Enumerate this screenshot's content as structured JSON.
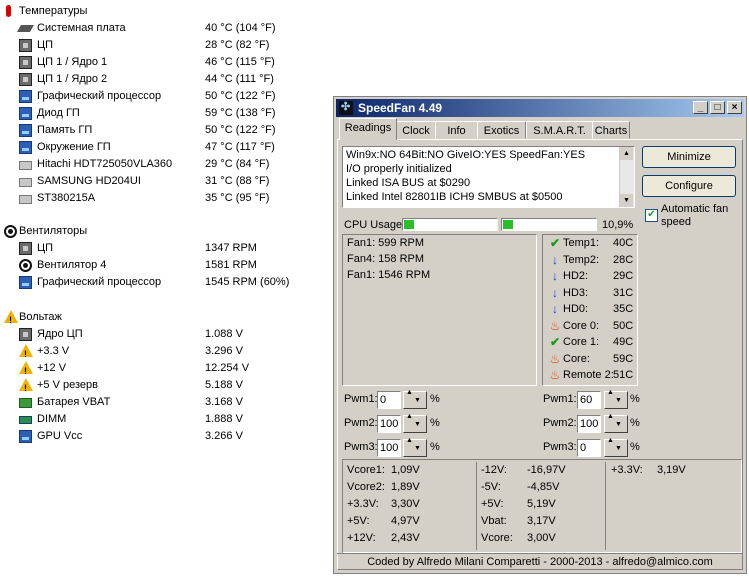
{
  "sensors": {
    "temps_header": "Температуры",
    "temps": [
      {
        "name": "Системная плата",
        "value": "40 °C  (104 °F)",
        "icon": "motherboard-icon"
      },
      {
        "name": "ЦП",
        "value": "28 °C  (82 °F)",
        "icon": "cpu-icon"
      },
      {
        "name": "ЦП 1 / Ядро 1",
        "value": "46 °C  (115 °F)",
        "icon": "cpu-icon"
      },
      {
        "name": "ЦП 1 / Ядро 2",
        "value": "44 °C  (111 °F)",
        "icon": "cpu-icon"
      },
      {
        "name": "Графический процессор",
        "value": "50 °C  (122 °F)",
        "icon": "gpu-icon"
      },
      {
        "name": "Диод ГП",
        "value": "59 °C  (138 °F)",
        "icon": "gpu-icon"
      },
      {
        "name": "Память ГП",
        "value": "50 °C  (122 °F)",
        "icon": "gpu-icon"
      },
      {
        "name": "Окружение ГП",
        "value": "47 °C  (117 °F)",
        "icon": "gpu-icon"
      },
      {
        "name": "Hitachi HDT725050VLA360",
        "value": "29 °C  (84 °F)",
        "icon": "disk-icon"
      },
      {
        "name": "SAMSUNG HD204UI",
        "value": "31 °C  (88 °F)",
        "icon": "disk-icon"
      },
      {
        "name": "ST380215A",
        "value": "35 °C  (95 °F)",
        "icon": "disk-icon"
      }
    ],
    "fans_header": "Вентиляторы",
    "fans": [
      {
        "name": "ЦП",
        "value": "1347 RPM",
        "icon": "cpu-icon"
      },
      {
        "name": "Вентилятор 4",
        "value": "1581 RPM",
        "icon": "fan-icon"
      },
      {
        "name": "Графический процессор",
        "value": "1545 RPM  (60%)",
        "icon": "gpu-icon"
      }
    ],
    "volts_header": "Вольтаж",
    "volts": [
      {
        "name": "Ядро ЦП",
        "value": "1.088 V",
        "icon": "cpu-icon"
      },
      {
        "name": "+3.3 V",
        "value": "3.296 V",
        "icon": "warning-icon"
      },
      {
        "name": "+12 V",
        "value": "12.254 V",
        "icon": "warning-icon"
      },
      {
        "name": "+5 V резерв",
        "value": "5.188 V",
        "icon": "warning-icon"
      },
      {
        "name": "Батарея VBAT",
        "value": "3.168 V",
        "icon": "battery-icon"
      },
      {
        "name": "DIMM",
        "value": "1.888 V",
        "icon": "ram-icon"
      },
      {
        "name": "GPU Vcc",
        "value": "3.266 V",
        "icon": "gpu-icon"
      }
    ]
  },
  "window": {
    "title": "SpeedFan 4.49",
    "tabs": [
      "Readings",
      "Clock",
      "Info",
      "Exotics",
      "S.M.A.R.T.",
      "Charts"
    ],
    "active_tab": "Readings",
    "log": [
      "Win9x:NO  64Bit:NO  GiveIO:YES  SpeedFan:YES",
      "I/O properly initialized",
      "Linked ISA BUS at $0290",
      "Linked Intel 82801IB ICH9 SMBUS at $0500"
    ],
    "buttons": {
      "minimize": "Minimize",
      "configure": "Configure"
    },
    "auto_fan_label": "Automatic fan speed",
    "auto_fan_checked": true,
    "cpu_usage_label": "CPU Usage",
    "cpu_usage_value": "10,9%",
    "fans": [
      "Fan1: 599 RPM",
      "Fan4: 158 RPM",
      "Fan1: 1546 RPM"
    ],
    "temps": [
      {
        "name": "Temp1:",
        "value": "40C",
        "status": "ok"
      },
      {
        "name": "Temp2:",
        "value": "28C",
        "status": "down"
      },
      {
        "name": "HD2:",
        "value": "29C",
        "status": "down"
      },
      {
        "name": "HD3:",
        "value": "31C",
        "status": "down"
      },
      {
        "name": "HD0:",
        "value": "35C",
        "status": "down"
      },
      {
        "name": "Core 0:",
        "value": "50C",
        "status": "hot"
      },
      {
        "name": "Core 1:",
        "value": "49C",
        "status": "ok"
      },
      {
        "name": "Core:",
        "value": "59C",
        "status": "hot"
      },
      {
        "name": "Remote 2:",
        "value": "51C",
        "status": "hot"
      }
    ],
    "pwm_left": [
      {
        "label": "Pwm1:",
        "value": "0"
      },
      {
        "label": "Pwm2:",
        "value": "100"
      },
      {
        "label": "Pwm3:",
        "value": "100"
      }
    ],
    "pwm_right": [
      {
        "label": "Pwm1:",
        "value": "60"
      },
      {
        "label": "Pwm2:",
        "value": "100"
      },
      {
        "label": "Pwm3:",
        "value": "0"
      }
    ],
    "pct": "%",
    "volts_col1": [
      [
        "Vcore1:",
        "1,09V"
      ],
      [
        "Vcore2:",
        "1,89V"
      ],
      [
        "+3.3V:",
        "3,30V"
      ],
      [
        "+5V:",
        "4,97V"
      ],
      [
        "+12V:",
        "2,43V"
      ]
    ],
    "volts_col2": [
      [
        "-12V:",
        "-16,97V"
      ],
      [
        "-5V:",
        "-4,85V"
      ],
      [
        "+5V:",
        "5,19V"
      ],
      [
        "Vbat:",
        "3,17V"
      ],
      [
        "Vcore:",
        "3,00V"
      ]
    ],
    "volts_col3": [
      [
        "+3.3V:",
        "3,19V"
      ]
    ],
    "footer": "Coded by Alfredo Milani Comparetti - 2000-2013 - alfredo@almico.com"
  }
}
